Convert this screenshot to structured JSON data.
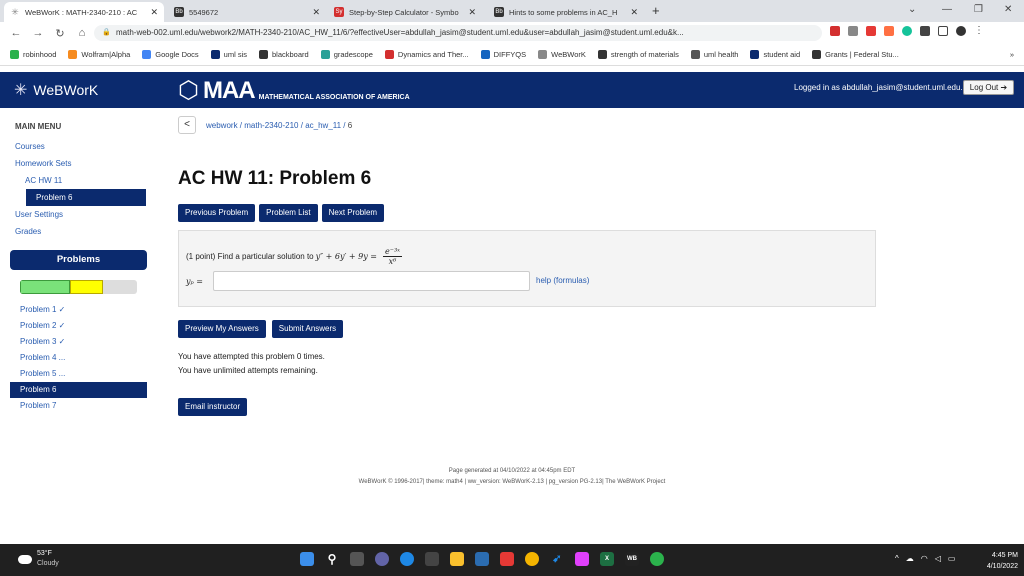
{
  "browser": {
    "tabs": [
      {
        "label": "WeBWorK : MATH-2340-210 : AC",
        "favicon": "webwork-star-icon",
        "active": true
      },
      {
        "label": "5549672",
        "favicon": "blackboard-icon",
        "active": false
      },
      {
        "label": "Step-by-Step Calculator - Symbo",
        "favicon": "symbolab-icon",
        "active": false
      },
      {
        "label": "Hints to some problems in AC_H",
        "favicon": "blackboard-icon",
        "active": false
      }
    ],
    "new_tab": "+",
    "url": "math-web-002.uml.edu/webwork2/MATH-2340-210/AC_HW_11/6/?effectiveUser=abdullah_jasim@student.uml.edu&user=abdullah_jasim@student.uml.edu&k...",
    "bookmarks": [
      {
        "label": "robinhood",
        "color": "#2bb24c"
      },
      {
        "label": "Wolfram|Alpha",
        "color": "#f68b1f"
      },
      {
        "label": "Google Docs",
        "color": "#4285f4"
      },
      {
        "label": "uml sis",
        "color": "#0b2a6e"
      },
      {
        "label": "blackboard",
        "color": "#333333"
      },
      {
        "label": "gradescope",
        "color": "#2aa198"
      },
      {
        "label": "Dynamics and Ther...",
        "color": "#d32f2f"
      },
      {
        "label": "DIFFYQS",
        "color": "#1565c0"
      },
      {
        "label": "WeBWorK",
        "color": "#888888"
      },
      {
        "label": "strength of materials",
        "color": "#333333"
      },
      {
        "label": "uml health",
        "color": "#555555"
      },
      {
        "label": "student aid",
        "color": "#0b2a6e"
      },
      {
        "label": "Grants | Federal Stu...",
        "color": "#333333"
      }
    ],
    "more": "»"
  },
  "header": {
    "app_name": "WeBWorK",
    "maa_logo": "MAA",
    "maa_subtitle": "MATHEMATICAL ASSOCIATION OF AMERICA",
    "logged_in": "Logged in as abdullah_jasim@student.uml.edu.",
    "logout_label": "Log Out ➔"
  },
  "sidebar": {
    "menu_title": "MAIN MENU",
    "items": [
      {
        "label": "Courses",
        "level": 0,
        "active": false
      },
      {
        "label": "Homework Sets",
        "level": 0,
        "active": false
      },
      {
        "label": "AC HW 11",
        "level": 1,
        "active": false
      },
      {
        "label": "Problem 6",
        "level": 2,
        "active": true
      },
      {
        "label": "User Settings",
        "level": 0,
        "active": false
      },
      {
        "label": "Grades",
        "level": 0,
        "active": false
      }
    ],
    "problems_title": "Problems",
    "progress": {
      "correct_fraction": 0.428,
      "incorrect_fraction": 0.0,
      "partial_fraction": 0.285
    },
    "problems": [
      {
        "label": "Problem 1 ✓",
        "active": false
      },
      {
        "label": "Problem 2 ✓",
        "active": false
      },
      {
        "label": "Problem 3 ✓",
        "active": false
      },
      {
        "label": "Problem 4 ...",
        "active": false
      },
      {
        "label": "Problem 5 ...",
        "active": false
      },
      {
        "label": "Problem 6",
        "active": true
      },
      {
        "label": "Problem 7",
        "active": false
      }
    ]
  },
  "main": {
    "breadcrumb": {
      "back": "<",
      "parts": [
        "webwork",
        "math-2340-210",
        "ac_hw_11"
      ],
      "current": "6"
    },
    "title": "AC HW 11: Problem 6",
    "nav": {
      "previous": "Previous Problem",
      "list": "Problem List",
      "next": "Next Problem"
    },
    "question": {
      "points": "(1 point) Find a particular solution to",
      "equation": "y″ + 6y′ + 9y =",
      "numerator": "e⁻³ˣ",
      "denominator": "x⁶",
      "answer_label": "yₚ =",
      "answer_value": "",
      "help_link": "help (formulas)"
    },
    "actions": {
      "preview": "Preview My Answers",
      "submit": "Submit Answers"
    },
    "attempts_line1": "You have attempted this problem 0 times.",
    "attempts_line2": "You have unlimited attempts remaining.",
    "email": "Email instructor"
  },
  "footer": {
    "generated": "Page generated at 04/10/2022 at 04:45pm EDT",
    "credits": "WeBWorK © 1996-2017| theme: math4 | ww_version: WeBWorK-2.13 | pg_version PG-2.13| The WeBWorK Project"
  },
  "taskbar": {
    "temperature": "53°F",
    "condition": "Cloudy",
    "time": "4:45 PM",
    "date": "4/10/2022"
  }
}
